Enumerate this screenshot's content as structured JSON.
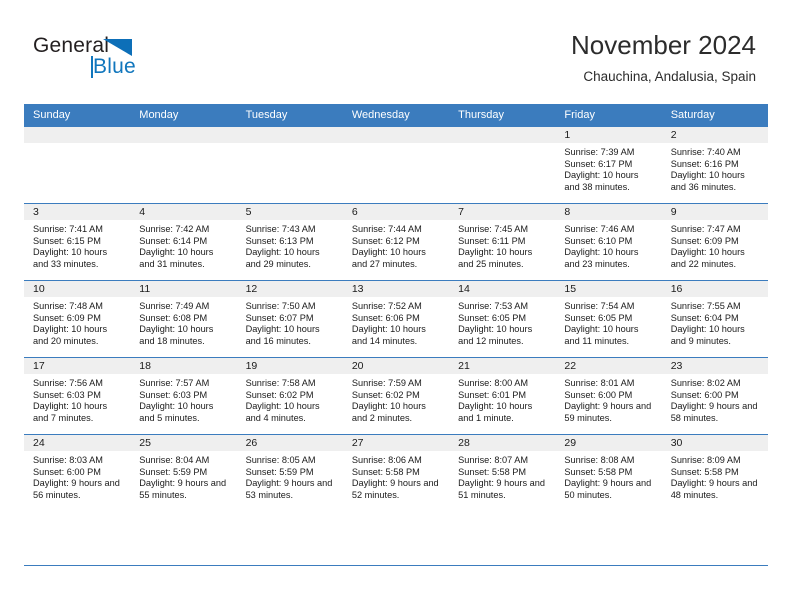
{
  "brand": {
    "name_top": "General",
    "name_bottom": "Blue",
    "accent_color": "#1076bd",
    "triangle_icon": "triangle-icon"
  },
  "header": {
    "title": "November 2024",
    "subtitle": "Chauchina, Andalusia, Spain"
  },
  "calendar": {
    "header_bg": "#3b7cbe",
    "daynum_bg": "#efefef",
    "weekday_headers": [
      "Sunday",
      "Monday",
      "Tuesday",
      "Wednesday",
      "Thursday",
      "Friday",
      "Saturday"
    ],
    "weeks": [
      [
        {
          "day": "",
          "sunrise": "",
          "sunset": "",
          "daylight": "",
          "empty": true
        },
        {
          "day": "",
          "sunrise": "",
          "sunset": "",
          "daylight": "",
          "empty": true
        },
        {
          "day": "",
          "sunrise": "",
          "sunset": "",
          "daylight": "",
          "empty": true
        },
        {
          "day": "",
          "sunrise": "",
          "sunset": "",
          "daylight": "",
          "empty": true
        },
        {
          "day": "",
          "sunrise": "",
          "sunset": "",
          "daylight": "",
          "empty": true
        },
        {
          "day": "1",
          "sunrise": "Sunrise: 7:39 AM",
          "sunset": "Sunset: 6:17 PM",
          "daylight": "Daylight: 10 hours and 38 minutes.",
          "empty": false
        },
        {
          "day": "2",
          "sunrise": "Sunrise: 7:40 AM",
          "sunset": "Sunset: 6:16 PM",
          "daylight": "Daylight: 10 hours and 36 minutes.",
          "empty": false
        }
      ],
      [
        {
          "day": "3",
          "sunrise": "Sunrise: 7:41 AM",
          "sunset": "Sunset: 6:15 PM",
          "daylight": "Daylight: 10 hours and 33 minutes.",
          "empty": false
        },
        {
          "day": "4",
          "sunrise": "Sunrise: 7:42 AM",
          "sunset": "Sunset: 6:14 PM",
          "daylight": "Daylight: 10 hours and 31 minutes.",
          "empty": false
        },
        {
          "day": "5",
          "sunrise": "Sunrise: 7:43 AM",
          "sunset": "Sunset: 6:13 PM",
          "daylight": "Daylight: 10 hours and 29 minutes.",
          "empty": false
        },
        {
          "day": "6",
          "sunrise": "Sunrise: 7:44 AM",
          "sunset": "Sunset: 6:12 PM",
          "daylight": "Daylight: 10 hours and 27 minutes.",
          "empty": false
        },
        {
          "day": "7",
          "sunrise": "Sunrise: 7:45 AM",
          "sunset": "Sunset: 6:11 PM",
          "daylight": "Daylight: 10 hours and 25 minutes.",
          "empty": false
        },
        {
          "day": "8",
          "sunrise": "Sunrise: 7:46 AM",
          "sunset": "Sunset: 6:10 PM",
          "daylight": "Daylight: 10 hours and 23 minutes.",
          "empty": false
        },
        {
          "day": "9",
          "sunrise": "Sunrise: 7:47 AM",
          "sunset": "Sunset: 6:09 PM",
          "daylight": "Daylight: 10 hours and 22 minutes.",
          "empty": false
        }
      ],
      [
        {
          "day": "10",
          "sunrise": "Sunrise: 7:48 AM",
          "sunset": "Sunset: 6:09 PM",
          "daylight": "Daylight: 10 hours and 20 minutes.",
          "empty": false
        },
        {
          "day": "11",
          "sunrise": "Sunrise: 7:49 AM",
          "sunset": "Sunset: 6:08 PM",
          "daylight": "Daylight: 10 hours and 18 minutes.",
          "empty": false
        },
        {
          "day": "12",
          "sunrise": "Sunrise: 7:50 AM",
          "sunset": "Sunset: 6:07 PM",
          "daylight": "Daylight: 10 hours and 16 minutes.",
          "empty": false
        },
        {
          "day": "13",
          "sunrise": "Sunrise: 7:52 AM",
          "sunset": "Sunset: 6:06 PM",
          "daylight": "Daylight: 10 hours and 14 minutes.",
          "empty": false
        },
        {
          "day": "14",
          "sunrise": "Sunrise: 7:53 AM",
          "sunset": "Sunset: 6:05 PM",
          "daylight": "Daylight: 10 hours and 12 minutes.",
          "empty": false
        },
        {
          "day": "15",
          "sunrise": "Sunrise: 7:54 AM",
          "sunset": "Sunset: 6:05 PM",
          "daylight": "Daylight: 10 hours and 11 minutes.",
          "empty": false
        },
        {
          "day": "16",
          "sunrise": "Sunrise: 7:55 AM",
          "sunset": "Sunset: 6:04 PM",
          "daylight": "Daylight: 10 hours and 9 minutes.",
          "empty": false
        }
      ],
      [
        {
          "day": "17",
          "sunrise": "Sunrise: 7:56 AM",
          "sunset": "Sunset: 6:03 PM",
          "daylight": "Daylight: 10 hours and 7 minutes.",
          "empty": false
        },
        {
          "day": "18",
          "sunrise": "Sunrise: 7:57 AM",
          "sunset": "Sunset: 6:03 PM",
          "daylight": "Daylight: 10 hours and 5 minutes.",
          "empty": false
        },
        {
          "day": "19",
          "sunrise": "Sunrise: 7:58 AM",
          "sunset": "Sunset: 6:02 PM",
          "daylight": "Daylight: 10 hours and 4 minutes.",
          "empty": false
        },
        {
          "day": "20",
          "sunrise": "Sunrise: 7:59 AM",
          "sunset": "Sunset: 6:02 PM",
          "daylight": "Daylight: 10 hours and 2 minutes.",
          "empty": false
        },
        {
          "day": "21",
          "sunrise": "Sunrise: 8:00 AM",
          "sunset": "Sunset: 6:01 PM",
          "daylight": "Daylight: 10 hours and 1 minute.",
          "empty": false
        },
        {
          "day": "22",
          "sunrise": "Sunrise: 8:01 AM",
          "sunset": "Sunset: 6:00 PM",
          "daylight": "Daylight: 9 hours and 59 minutes.",
          "empty": false
        },
        {
          "day": "23",
          "sunrise": "Sunrise: 8:02 AM",
          "sunset": "Sunset: 6:00 PM",
          "daylight": "Daylight: 9 hours and 58 minutes.",
          "empty": false
        }
      ],
      [
        {
          "day": "24",
          "sunrise": "Sunrise: 8:03 AM",
          "sunset": "Sunset: 6:00 PM",
          "daylight": "Daylight: 9 hours and 56 minutes.",
          "empty": false
        },
        {
          "day": "25",
          "sunrise": "Sunrise: 8:04 AM",
          "sunset": "Sunset: 5:59 PM",
          "daylight": "Daylight: 9 hours and 55 minutes.",
          "empty": false
        },
        {
          "day": "26",
          "sunrise": "Sunrise: 8:05 AM",
          "sunset": "Sunset: 5:59 PM",
          "daylight": "Daylight: 9 hours and 53 minutes.",
          "empty": false
        },
        {
          "day": "27",
          "sunrise": "Sunrise: 8:06 AM",
          "sunset": "Sunset: 5:58 PM",
          "daylight": "Daylight: 9 hours and 52 minutes.",
          "empty": false
        },
        {
          "day": "28",
          "sunrise": "Sunrise: 8:07 AM",
          "sunset": "Sunset: 5:58 PM",
          "daylight": "Daylight: 9 hours and 51 minutes.",
          "empty": false
        },
        {
          "day": "29",
          "sunrise": "Sunrise: 8:08 AM",
          "sunset": "Sunset: 5:58 PM",
          "daylight": "Daylight: 9 hours and 50 minutes.",
          "empty": false
        },
        {
          "day": "30",
          "sunrise": "Sunrise: 8:09 AM",
          "sunset": "Sunset: 5:58 PM",
          "daylight": "Daylight: 9 hours and 48 minutes.",
          "empty": false
        }
      ]
    ]
  }
}
